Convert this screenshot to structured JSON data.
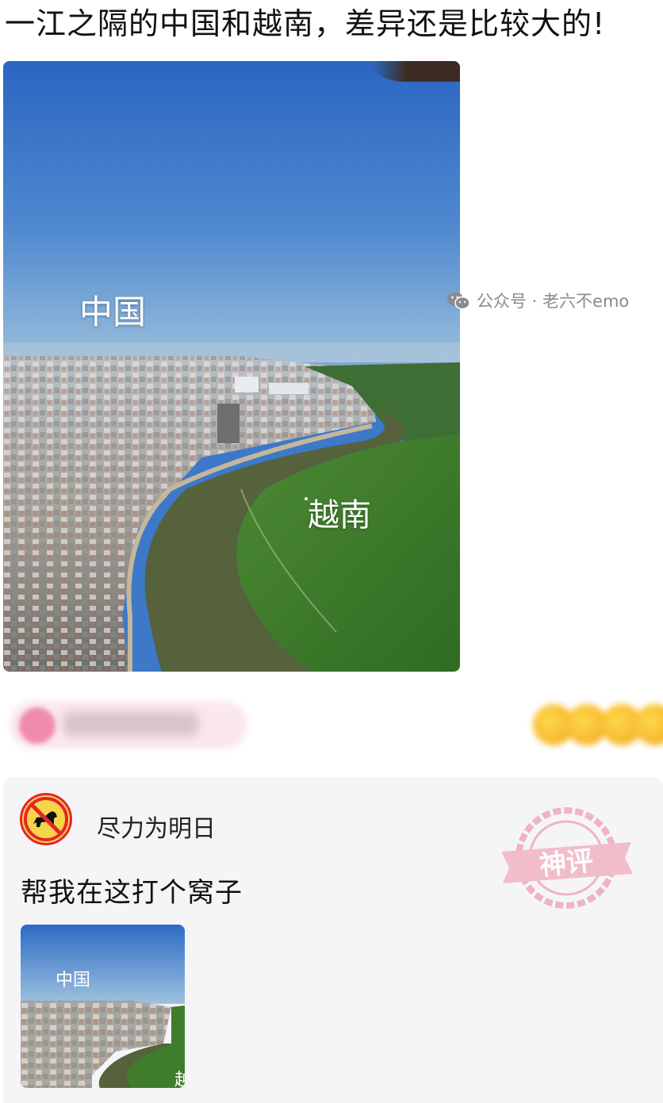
{
  "post": {
    "title": "一江之隔的中国和越南，差异还是比较大的!",
    "photo": {
      "label_china": "中国",
      "label_vietnam": "越南"
    }
  },
  "reaction_bar": {
    "user_chip": "blurred",
    "emoji_reactions": "blurred"
  },
  "comment": {
    "avatar_icon": "no-dog-icon",
    "username": "尽力为明日",
    "text": "帮我在这打个窝子",
    "stamp_text": "神评",
    "thumbnail": {
      "label_china": "中国",
      "label_cut": "越"
    }
  },
  "watermark": {
    "icon": "wechat-icon",
    "text": "公众号 · 老六不emo"
  },
  "colors": {
    "sky_top": "#2f6fc4",
    "sky_bottom": "#8fb6d9",
    "river": "#5b6b3f",
    "vegetation": "#3f7d2c",
    "card_bg": "#f5f5f8",
    "stamp_pink": "#f0a8b8"
  }
}
